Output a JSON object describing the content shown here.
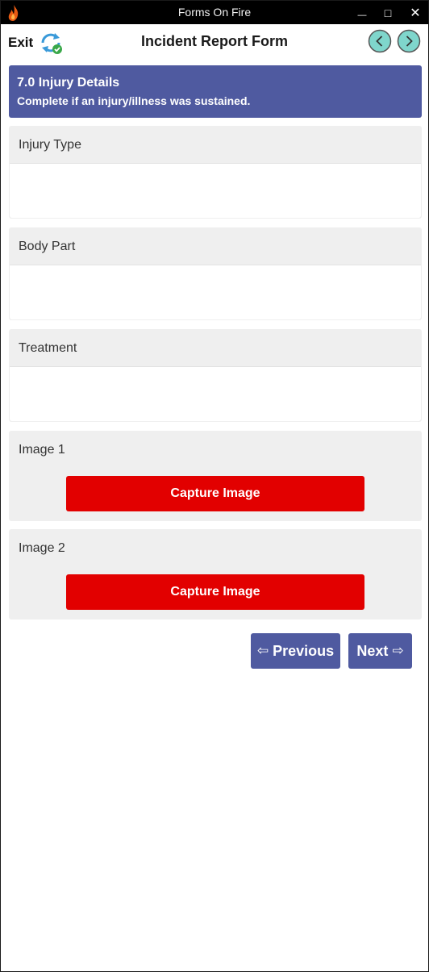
{
  "window": {
    "title": "Forms On Fire",
    "min_glyph": "—",
    "max_glyph": "□",
    "close_glyph": "✕"
  },
  "header": {
    "exit_label": "Exit",
    "title": "Incident Report Form",
    "sync_icon": "sync-icon",
    "prev_icon": "chevron-left-icon",
    "next_icon": "chevron-right-icon"
  },
  "section": {
    "title": "7.0 Injury Details",
    "subtitle": "Complete if an injury/illness was sustained."
  },
  "fields": [
    {
      "label": "Injury Type",
      "value": ""
    },
    {
      "label": "Body Part",
      "value": ""
    },
    {
      "label": "Treatment",
      "value": ""
    }
  ],
  "images": [
    {
      "label": "Image 1",
      "button": "Capture Image"
    },
    {
      "label": "Image 2",
      "button": "Capture Image"
    }
  ],
  "pager": {
    "prev_arrow": "⇦",
    "prev_label": "Previous",
    "next_label": "Next",
    "next_arrow": "⇨"
  },
  "colors": {
    "banner": "#4f5aa0",
    "capture": "#e20000",
    "nav_circle": "#7fd6cc"
  }
}
